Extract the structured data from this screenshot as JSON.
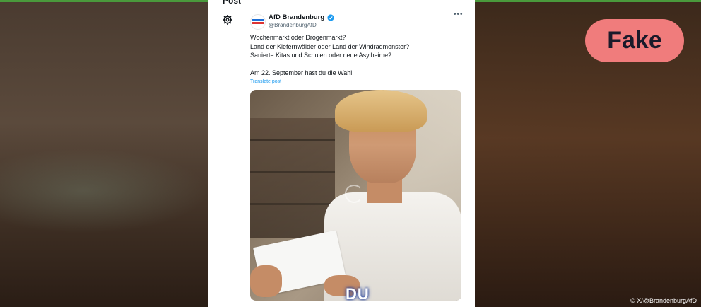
{
  "post": {
    "header_label": "Post",
    "account_name": "AfD Brandenburg",
    "handle": "@BrandenburgAfD",
    "more_label": "•••",
    "lines": [
      "Wochenmarkt oder Drogenmarkt?",
      "Land der Kiefernwälder oder Land der Windradmonster?",
      "Sanierte Kitas und Schulen oder neue Asylheime?",
      "Am 22. September hast du die Wahl."
    ],
    "translate_label": "Translate post",
    "image_overlay_text": "DU"
  },
  "badge": {
    "label": "Fake",
    "color": "#f07c7c"
  },
  "credit": "© X/@BrandenburgAfD",
  "icons": {
    "gear": "gear-icon",
    "verified": "verified-badge-icon",
    "more": "more-options-icon",
    "avatar": "account-avatar"
  }
}
